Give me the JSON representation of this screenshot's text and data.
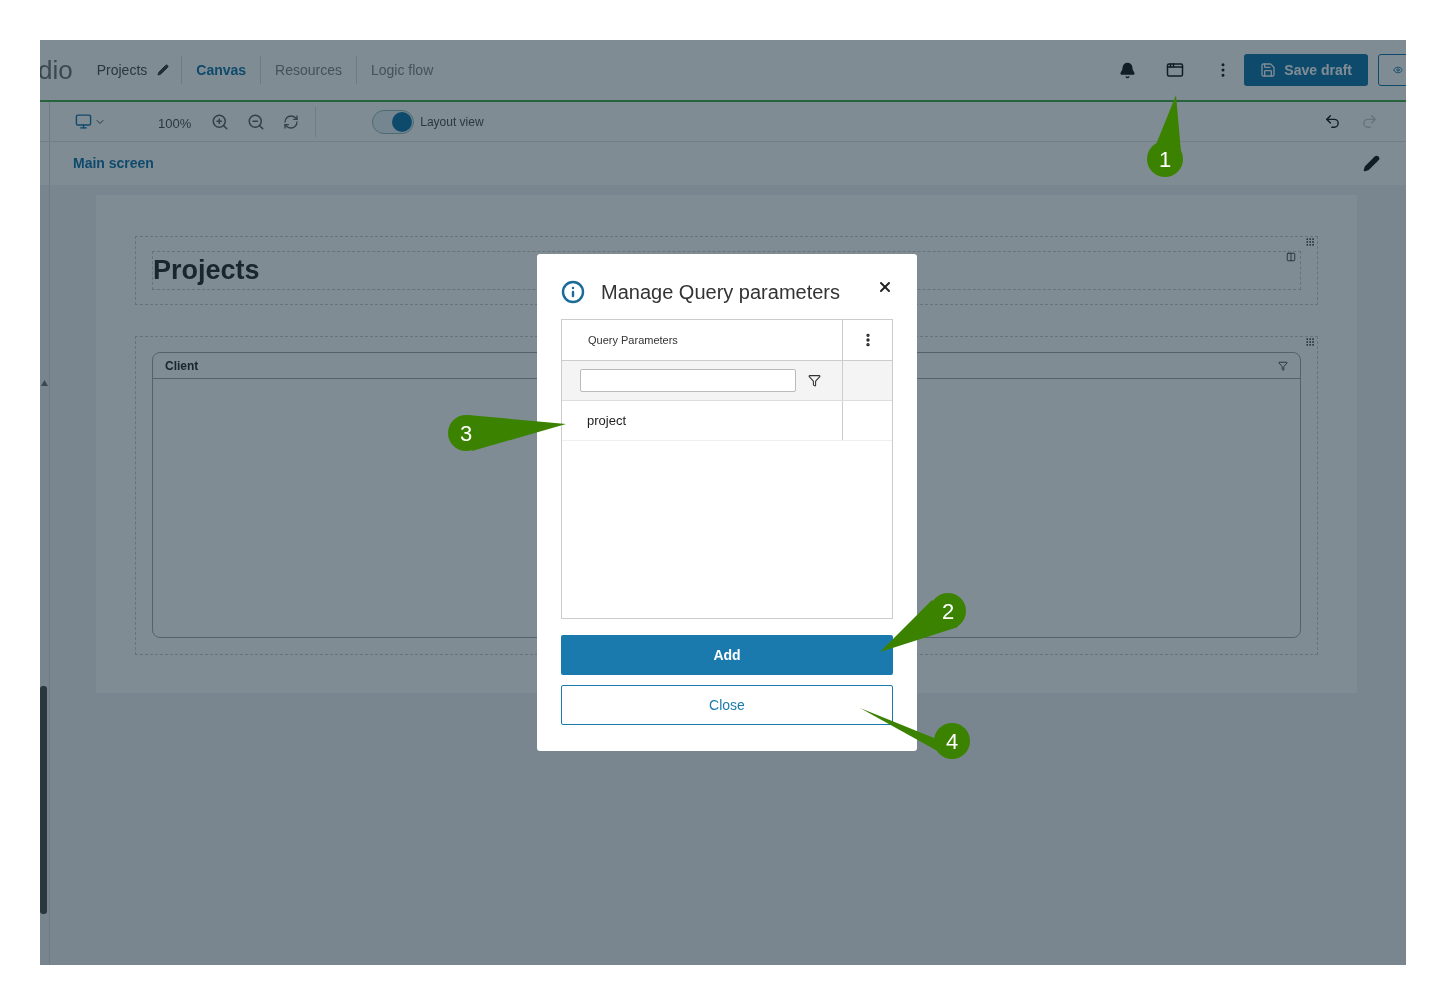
{
  "header": {
    "logo": "dio",
    "project": "Projects",
    "tabs": [
      {
        "label": "Canvas",
        "selected": true
      },
      {
        "label": "Resources",
        "selected": false
      },
      {
        "label": "Logic flow",
        "selected": false
      }
    ],
    "save_button": "Save draft"
  },
  "toolbar": {
    "zoom": "100%",
    "layout_toggle": {
      "label": "Layout view",
      "on": true
    },
    "redo_disabled": true
  },
  "screen_bar": {
    "title": "Main screen"
  },
  "canvas": {
    "heading": "Projects",
    "card_header": "Client"
  },
  "dialog": {
    "title": "Manage Query parameters",
    "grid_header": "Query Parameters",
    "rows": [
      "project"
    ],
    "buttons": [
      {
        "label": "Add",
        "kind": "primary"
      },
      {
        "label": "Close",
        "kind": "outline"
      }
    ]
  },
  "callouts": [
    "1",
    "2",
    "3",
    "4"
  ]
}
